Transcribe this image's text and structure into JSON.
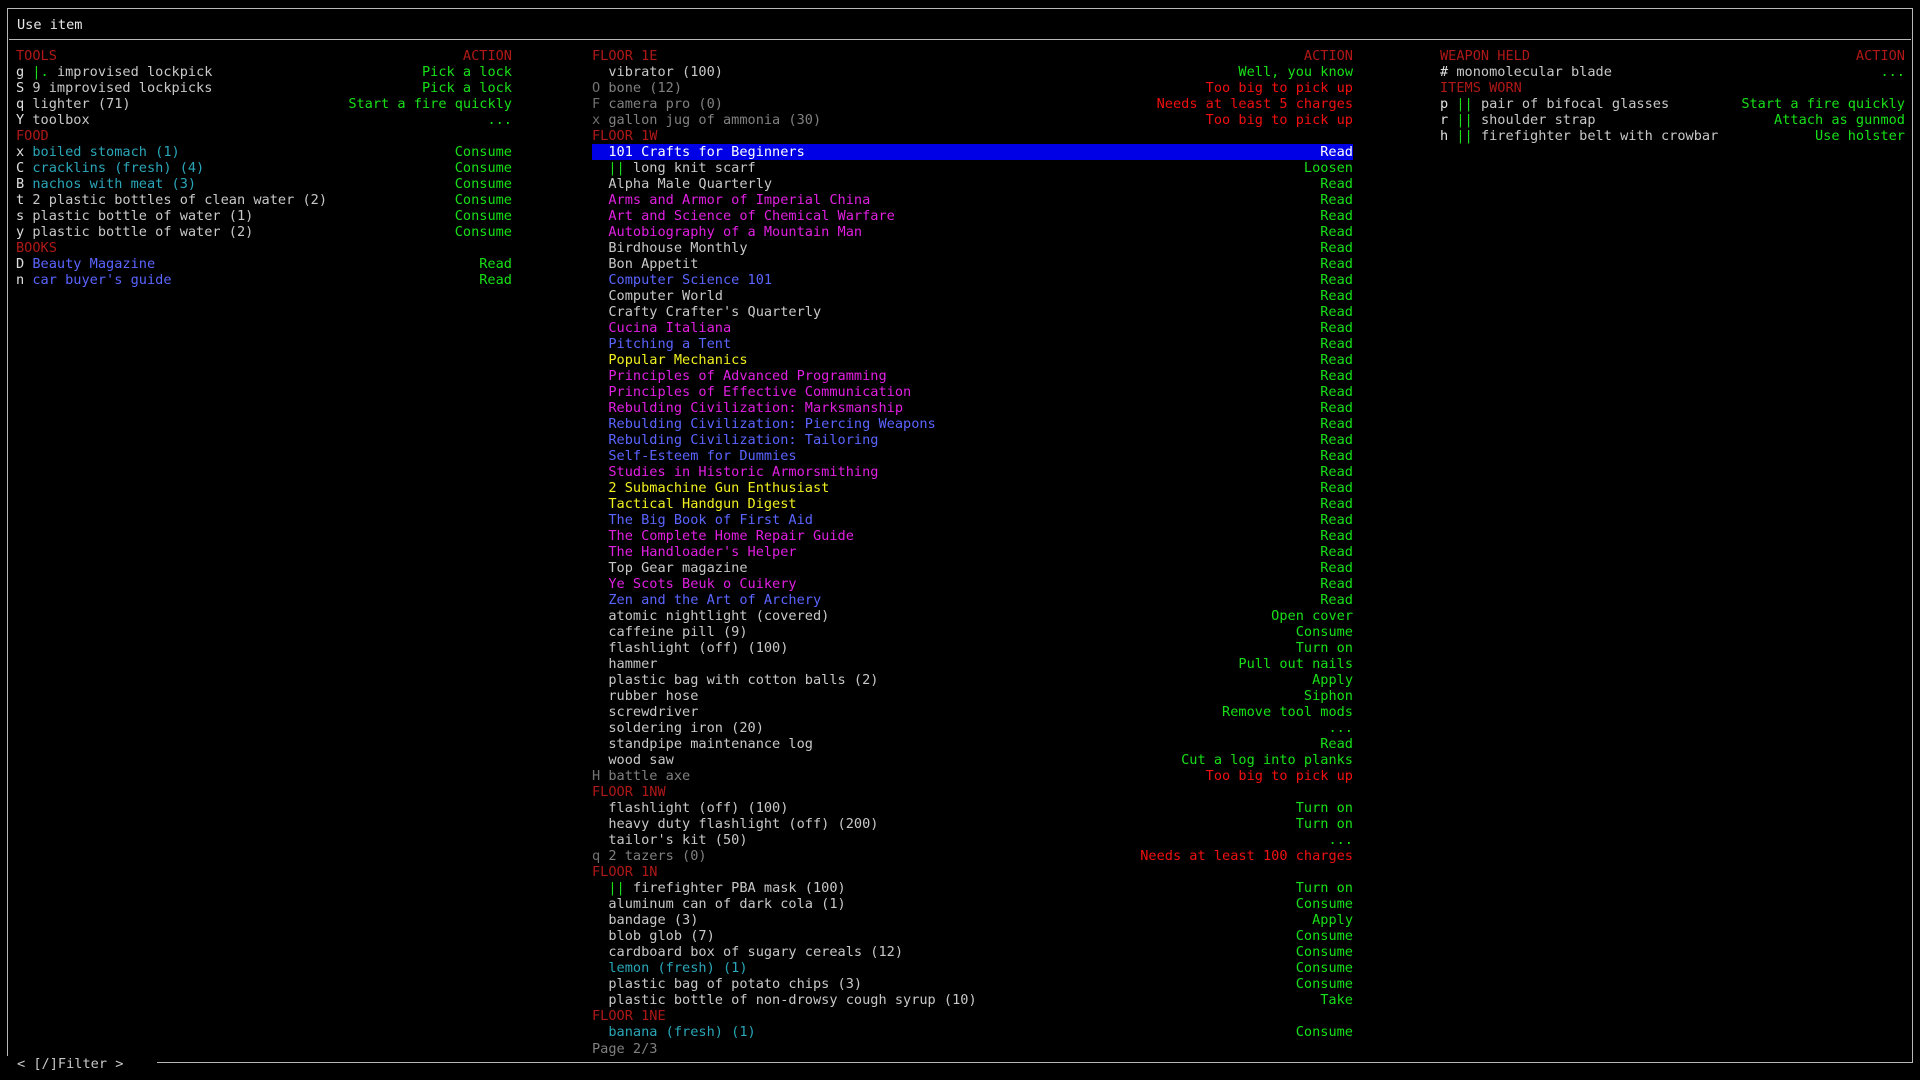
{
  "window": {
    "title": "Use item"
  },
  "filter_label": "< [/]Filter >",
  "page_indicator": "Page 2/3",
  "colors": {
    "green": "#18e018",
    "red": "#f01010",
    "header": "#b01818",
    "selection": "#0000e6",
    "cyan": "#2aa6b8",
    "blue": "#5a64ff",
    "magenta": "#e020e0",
    "yellow": "#f0f020"
  },
  "left": {
    "rows": [
      {
        "type": "header",
        "name": "TOOLS",
        "action": "ACTION"
      },
      {
        "key": "g",
        "mark": "|.",
        "name": "improvised lockpick",
        "action": "Pick a lock",
        "color": "g",
        "acolor": "gr"
      },
      {
        "key": "S",
        "name": "9 improvised lockpicks",
        "action": "Pick a lock",
        "color": "g",
        "acolor": "gr"
      },
      {
        "key": "q",
        "name": "lighter (71)",
        "action": "Start a fire quickly",
        "color": "g",
        "acolor": "gr"
      },
      {
        "key": "Y",
        "name": "toolbox",
        "action": "...",
        "color": "g",
        "acolor": "gr"
      },
      {
        "type": "header",
        "name": "FOOD",
        "action": ""
      },
      {
        "key": "x",
        "name": "boiled stomach (1)",
        "action": "Consume",
        "color": "cy",
        "acolor": "gr"
      },
      {
        "key": "C",
        "name": "cracklins (fresh) (4)",
        "action": "Consume",
        "color": "cy",
        "acolor": "gr"
      },
      {
        "key": "B",
        "name": "nachos with meat (3)",
        "action": "Consume",
        "color": "cy",
        "acolor": "gr"
      },
      {
        "key": "t",
        "name": "2 plastic bottles of clean water (2)",
        "action": "Consume",
        "color": "g",
        "acolor": "gr"
      },
      {
        "key": "s",
        "name": "plastic bottle of water (1)",
        "action": "Consume",
        "color": "g",
        "acolor": "gr"
      },
      {
        "key": "y",
        "name": "plastic bottle of water (2)",
        "action": "Consume",
        "color": "g",
        "acolor": "gr"
      },
      {
        "type": "header",
        "name": "BOOKS",
        "action": ""
      },
      {
        "key": "D",
        "name": "Beauty Magazine",
        "action": "Read",
        "color": "bl",
        "acolor": "gr"
      },
      {
        "key": "n",
        "name": "car buyer's guide",
        "action": "Read",
        "color": "bl",
        "acolor": "gr"
      }
    ]
  },
  "middle": {
    "rows": [
      {
        "type": "header",
        "name": "FLOOR 1E",
        "action": "ACTION"
      },
      {
        "key": "",
        "name": "vibrator (100)",
        "action": "Well, you know",
        "color": "g",
        "acolor": "gr",
        "indent": 1
      },
      {
        "key": "O",
        "name": "bone (12)",
        "action": "Too big to pick up",
        "color": "dim",
        "acolor": "rd",
        "dimkey": true
      },
      {
        "key": "F",
        "name": "camera pro (0)",
        "action": "Needs at least 5 charges",
        "color": "dim",
        "acolor": "rd",
        "dimkey": true
      },
      {
        "key": "x",
        "name": "gallon jug of ammonia (30)",
        "action": "Too big to pick up",
        "color": "dim",
        "acolor": "rd",
        "dimkey": true
      },
      {
        "type": "header",
        "name": "FLOOR 1W",
        "action": ""
      },
      {
        "key": "",
        "name": "101 Crafts for Beginners",
        "action": "Read",
        "color": "wh",
        "acolor": "wh",
        "indent": 1,
        "selected": true
      },
      {
        "key": "",
        "mark": "||",
        "name": "long knit scarf",
        "action": "Loosen",
        "color": "g",
        "acolor": "gr",
        "indent": 1
      },
      {
        "key": "",
        "name": "Alpha Male Quarterly",
        "action": "Read",
        "color": "g",
        "acolor": "gr",
        "indent": 1
      },
      {
        "key": "",
        "name": "Arms and Armor of Imperial China",
        "action": "Read",
        "color": "mg",
        "acolor": "gr",
        "indent": 1
      },
      {
        "key": "",
        "name": "Art and Science of Chemical Warfare",
        "action": "Read",
        "color": "mg",
        "acolor": "gr",
        "indent": 1
      },
      {
        "key": "",
        "name": "Autobiography of a Mountain Man",
        "action": "Read",
        "color": "mg",
        "acolor": "gr",
        "indent": 1
      },
      {
        "key": "",
        "name": "Birdhouse Monthly",
        "action": "Read",
        "color": "g",
        "acolor": "gr",
        "indent": 1
      },
      {
        "key": "",
        "name": "Bon Appetit",
        "action": "Read",
        "color": "g",
        "acolor": "gr",
        "indent": 1
      },
      {
        "key": "",
        "name": "Computer Science 101",
        "action": "Read",
        "color": "bl",
        "acolor": "gr",
        "indent": 1
      },
      {
        "key": "",
        "name": "Computer World",
        "action": "Read",
        "color": "g",
        "acolor": "gr",
        "indent": 1
      },
      {
        "key": "",
        "name": "Crafty Crafter's Quarterly",
        "action": "Read",
        "color": "g",
        "acolor": "gr",
        "indent": 1
      },
      {
        "key": "",
        "name": "Cucina Italiana",
        "action": "Read",
        "color": "mg",
        "acolor": "gr",
        "indent": 1
      },
      {
        "key": "",
        "name": "Pitching a Tent",
        "action": "Read",
        "color": "bl",
        "acolor": "gr",
        "indent": 1
      },
      {
        "key": "",
        "name": "Popular Mechanics",
        "action": "Read",
        "color": "ye",
        "acolor": "gr",
        "indent": 1
      },
      {
        "key": "",
        "name": "Principles of Advanced Programming",
        "action": "Read",
        "color": "mg",
        "acolor": "gr",
        "indent": 1
      },
      {
        "key": "",
        "name": "Principles of Effective Communication",
        "action": "Read",
        "color": "mg",
        "acolor": "gr",
        "indent": 1
      },
      {
        "key": "",
        "name": "Rebulding Civilization: Marksmanship",
        "action": "Read",
        "color": "mg",
        "acolor": "gr",
        "indent": 1
      },
      {
        "key": "",
        "name": "Rebulding Civilization: Piercing Weapons",
        "action": "Read",
        "color": "bl",
        "acolor": "gr",
        "indent": 1
      },
      {
        "key": "",
        "name": "Rebulding Civilization: Tailoring",
        "action": "Read",
        "color": "bl",
        "acolor": "gr",
        "indent": 1
      },
      {
        "key": "",
        "name": "Self-Esteem for Dummies",
        "action": "Read",
        "color": "bl",
        "acolor": "gr",
        "indent": 1
      },
      {
        "key": "",
        "name": "Studies in Historic Armorsmithing",
        "action": "Read",
        "color": "mg",
        "acolor": "gr",
        "indent": 1
      },
      {
        "key": "",
        "name": "2 Submachine Gun Enthusiast",
        "action": "Read",
        "color": "ye",
        "acolor": "gr",
        "indent": 1
      },
      {
        "key": "",
        "name": "Tactical Handgun Digest",
        "action": "Read",
        "color": "ye",
        "acolor": "gr",
        "indent": 1
      },
      {
        "key": "",
        "name": "The Big Book of First Aid",
        "action": "Read",
        "color": "bl",
        "acolor": "gr",
        "indent": 1
      },
      {
        "key": "",
        "name": "The Complete Home Repair Guide",
        "action": "Read",
        "color": "mg",
        "acolor": "gr",
        "indent": 1
      },
      {
        "key": "",
        "name": "The Handloader's Helper",
        "action": "Read",
        "color": "mg",
        "acolor": "gr",
        "indent": 1
      },
      {
        "key": "",
        "name": "Top Gear magazine",
        "action": "Read",
        "color": "g",
        "acolor": "gr",
        "indent": 1
      },
      {
        "key": "",
        "name": "Ye Scots Beuk o Cuikery",
        "action": "Read",
        "color": "mg",
        "acolor": "gr",
        "indent": 1
      },
      {
        "key": "",
        "name": "Zen and the Art of Archery",
        "action": "Read",
        "color": "bl",
        "acolor": "gr",
        "indent": 1
      },
      {
        "key": "",
        "name": "atomic nightlight (covered)",
        "action": "Open cover",
        "color": "g",
        "acolor": "gr",
        "indent": 1
      },
      {
        "key": "",
        "name": "caffeine pill (9)",
        "action": "Consume",
        "color": "g",
        "acolor": "gr",
        "indent": 1
      },
      {
        "key": "",
        "name": "flashlight (off) (100)",
        "action": "Turn on",
        "color": "g",
        "acolor": "gr",
        "indent": 1
      },
      {
        "key": "",
        "name": "hammer",
        "action": "Pull out nails",
        "color": "g",
        "acolor": "gr",
        "indent": 1
      },
      {
        "key": "",
        "name": "plastic bag with cotton balls (2)",
        "action": "Apply",
        "color": "g",
        "acolor": "gr",
        "indent": 1
      },
      {
        "key": "",
        "name": "rubber hose",
        "action": "Siphon",
        "color": "g",
        "acolor": "gr",
        "indent": 1
      },
      {
        "key": "",
        "name": "screwdriver",
        "action": "Remove tool mods",
        "color": "g",
        "acolor": "gr",
        "indent": 1
      },
      {
        "key": "",
        "name": "soldering iron (20)",
        "action": "...",
        "color": "g",
        "acolor": "gr",
        "indent": 1
      },
      {
        "key": "",
        "name": "standpipe maintenance log",
        "action": "Read",
        "color": "g",
        "acolor": "gr",
        "indent": 1
      },
      {
        "key": "",
        "name": "wood saw",
        "action": "Cut a log into planks",
        "color": "g",
        "acolor": "gr",
        "indent": 1
      },
      {
        "key": "H",
        "name": "battle axe",
        "action": "Too big to pick up",
        "color": "dim",
        "acolor": "rd",
        "dimkey": true
      },
      {
        "type": "header",
        "name": "FLOOR 1NW",
        "action": ""
      },
      {
        "key": "",
        "name": "flashlight (off) (100)",
        "action": "Turn on",
        "color": "g",
        "acolor": "gr",
        "indent": 1
      },
      {
        "key": "",
        "name": "heavy duty flashlight (off) (200)",
        "action": "Turn on",
        "color": "g",
        "acolor": "gr",
        "indent": 1
      },
      {
        "key": "",
        "name": "tailor's kit (50)",
        "action": "...",
        "color": "g",
        "acolor": "gr",
        "indent": 1
      },
      {
        "key": "q",
        "name": "2 tazers (0)",
        "action": "Needs at least 100 charges",
        "color": "dim",
        "acolor": "rd",
        "dimkey": true
      },
      {
        "type": "header",
        "name": "FLOOR 1N",
        "action": ""
      },
      {
        "key": "",
        "mark": "||",
        "name": "firefighter PBA mask (100)",
        "action": "Turn on",
        "color": "g",
        "acolor": "gr",
        "indent": 1
      },
      {
        "key": "",
        "name": "aluminum can of dark cola (1)",
        "action": "Consume",
        "color": "g",
        "acolor": "gr",
        "indent": 1
      },
      {
        "key": "",
        "name": "bandage (3)",
        "action": "Apply",
        "color": "g",
        "acolor": "gr",
        "indent": 1
      },
      {
        "key": "",
        "name": "blob glob (7)",
        "action": "Consume",
        "color": "g",
        "acolor": "gr",
        "indent": 1
      },
      {
        "key": "",
        "name": "cardboard box of sugary cereals (12)",
        "action": "Consume",
        "color": "g",
        "acolor": "gr",
        "indent": 1
      },
      {
        "key": "",
        "name": "lemon (fresh) (1)",
        "action": "Consume",
        "color": "cy",
        "acolor": "gr",
        "indent": 1
      },
      {
        "key": "",
        "name": "plastic bag of potato chips (3)",
        "action": "Consume",
        "color": "g",
        "acolor": "gr",
        "indent": 1
      },
      {
        "key": "",
        "name": "plastic bottle of non-drowsy cough syrup (10)",
        "action": "Take",
        "color": "g",
        "acolor": "gr",
        "indent": 1
      },
      {
        "type": "header",
        "name": "FLOOR 1NE",
        "action": ""
      },
      {
        "key": "",
        "name": "banana (fresh) (1)",
        "action": "Consume",
        "color": "cy",
        "acolor": "gr",
        "indent": 1
      }
    ]
  },
  "right": {
    "rows": [
      {
        "type": "header",
        "name": "WEAPON HELD",
        "action": "ACTION"
      },
      {
        "key": "#",
        "name": "monomolecular blade",
        "action": "...",
        "color": "g",
        "acolor": "gr"
      },
      {
        "type": "header",
        "name": "ITEMS WORN",
        "action": ""
      },
      {
        "key": "p",
        "mark": "||",
        "name": "pair of bifocal glasses",
        "action": "Start a fire quickly",
        "color": "g",
        "acolor": "gr"
      },
      {
        "key": "r",
        "mark": "||",
        "name": "shoulder strap",
        "action": "Attach as gunmod",
        "color": "g",
        "acolor": "gr"
      },
      {
        "key": "h",
        "mark": "||",
        "name": "firefighter belt with crowbar",
        "action": "Use holster",
        "color": "g",
        "acolor": "gr"
      }
    ]
  }
}
